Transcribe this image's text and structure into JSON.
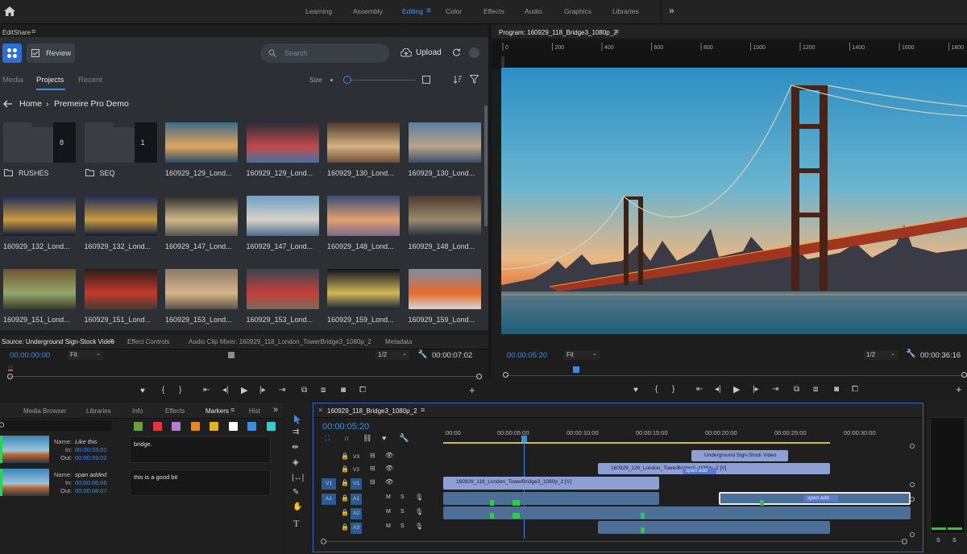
{
  "workspaces": [
    "Learning",
    "Assembly",
    "Editing",
    "Color",
    "Effects",
    "Audio",
    "Graphics",
    "Libraries"
  ],
  "active_workspace": "Editing",
  "more_glyph": "»",
  "editshare": {
    "panel_title": "EditShare",
    "review_label": "Review",
    "search_placeholder": "Search",
    "upload_label": "Upload",
    "tabs": [
      "Media",
      "Projects",
      "Recent"
    ],
    "active_tab": "Projects",
    "size_label": "Size",
    "breadcrumb_home": "Home",
    "breadcrumb_sep": "›",
    "breadcrumb_current": "Premeire Pro Demo",
    "items": [
      {
        "label": "RUSHES",
        "type": "folder",
        "count": "8"
      },
      {
        "label": "SEQ",
        "type": "folder",
        "count": "1"
      },
      {
        "label": "160929_129_Lond..."
      },
      {
        "label": "160929_129_Lond..."
      },
      {
        "label": "160929_130_Lond..."
      },
      {
        "label": "160929_130_Lond..."
      },
      {
        "label": "160929_132_Lond..."
      },
      {
        "label": "160929_132_Lond..."
      },
      {
        "label": "160929_147_Lond..."
      },
      {
        "label": "160929_147_Lond..."
      },
      {
        "label": "160929_148_Lond..."
      },
      {
        "label": "160929_148_Lond..."
      },
      {
        "label": "160929_151_Lond..."
      },
      {
        "label": "160929_151_Lond..."
      },
      {
        "label": "160929_153_Lond..."
      },
      {
        "label": "160929_153_Lond..."
      },
      {
        "label": "160929_159_Lond..."
      },
      {
        "label": "160929_159_Lond..."
      }
    ]
  },
  "program": {
    "title": "Program: 160929_118_Bridge3_1080p_2",
    "ruler": [
      "0",
      "200",
      "400",
      "600",
      "800",
      "1000",
      "1200",
      "1400",
      "1600",
      "1800"
    ],
    "timecode": "00:00:05:20",
    "fit": "Fit",
    "ratio": "1/2",
    "duration": "00:00:36:16"
  },
  "source": {
    "tabs": [
      "Source: Underground Sign-Stock Video",
      "Effect Controls",
      "Audio Clip Mixer: 160929_118_London_TowerBridge3_1080p_2",
      "Metadata"
    ],
    "timecode": "00:00:00:00",
    "fit": "Fit",
    "ratio": "1/2",
    "duration": "00:00:07:02"
  },
  "markers": {
    "tabs": [
      "Media Browser",
      "Libraries",
      "Info",
      "Effects",
      "Markers",
      "Hist"
    ],
    "colors": [
      "#6aa03c",
      "#e0363d",
      "#b67fd0",
      "#f0831e",
      "#e6b122",
      "#ffffff",
      "#3b8de4",
      "#2fd0c9"
    ],
    "entries": [
      {
        "name_label": "Name:",
        "name": "Like this",
        "in_label": "In:",
        "in": "00:00:03:02",
        "out_label": "Out:",
        "out": "00:00:03:02",
        "comment": "bridge."
      },
      {
        "name_label": "Name:",
        "name": "span added",
        "in_label": "In:",
        "in": "00:00:06:06",
        "out_label": "Out:",
        "out": "00:00:08:07",
        "comment": "this is a good bit"
      }
    ]
  },
  "timeline": {
    "title": "160929_118_Bridge3_1080p_2",
    "timecode": "00:00:05:20",
    "ruler": [
      ":00:00",
      "00:00:05:00",
      "00:00:10:00",
      "00:00:15:00",
      "00:00:20:00",
      "00:00:25:00",
      "00:00:30:00"
    ],
    "tracks_v": [
      "V3",
      "V2",
      "V1"
    ],
    "tracks_a": [
      "A1",
      "A2",
      "A3"
    ],
    "src_v": "V1",
    "src_a": "A1",
    "clips": {
      "v3": "Underground Sign-Stock Video",
      "v2": "160929_126_London_TowerBridge3_1080p_2 [V]",
      "v1": "160929_118_London_TowerBridge3_1080p_2 [V]",
      "span": "span add",
      "span2": "span add"
    },
    "meter_labels": [
      "S",
      "S"
    ]
  }
}
